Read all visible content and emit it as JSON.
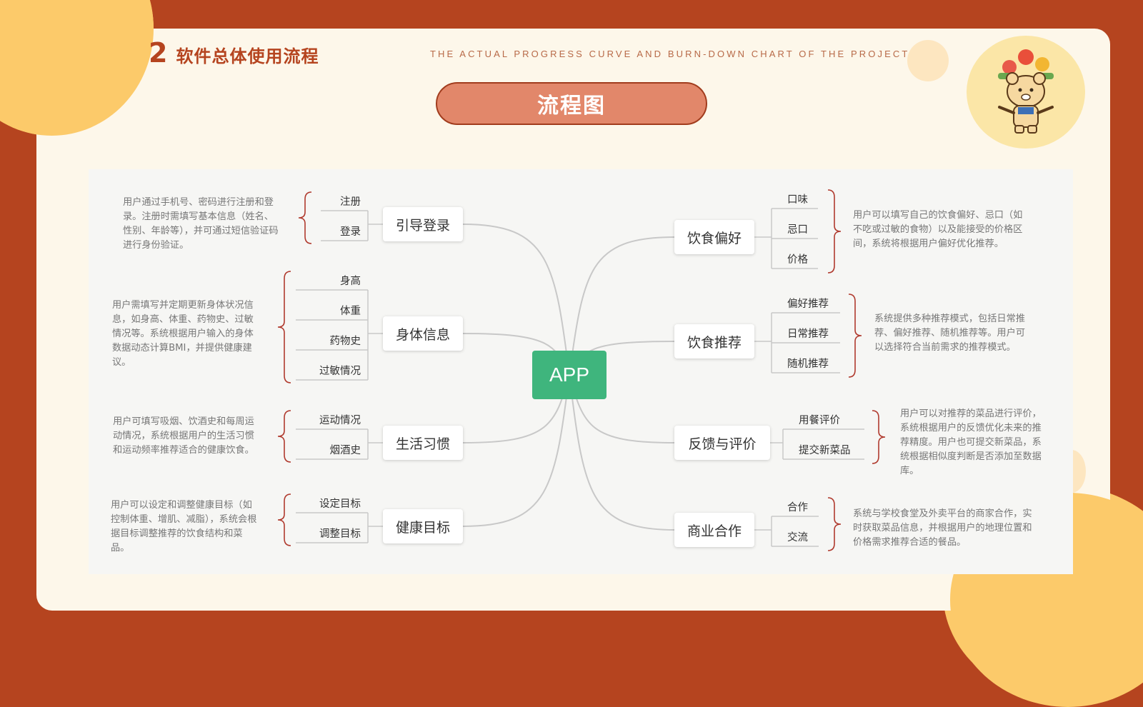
{
  "header": {
    "section_number": "2",
    "section_title": "软件总体使用流程",
    "subtitle": "THE ACTUAL PROGRESS CURVE AND BURN-DOWN CHART OF THE PROJECT",
    "badge": "流程图"
  },
  "diagram": {
    "center": "APP",
    "left": [
      {
        "label": "引导登录",
        "children": [
          "注册",
          "登录"
        ],
        "description": "用户通过手机号、密码进行注册和登录。注册时需填写基本信息（姓名、性别、年龄等），并可通过短信验证码进行身份验证。"
      },
      {
        "label": "身体信息",
        "children": [
          "身高",
          "体重",
          "药物史",
          "过敏情况"
        ],
        "description": "用户需填写并定期更新身体状况信息，如身高、体重、药物史、过敏情况等。系统根据用户输入的身体数据动态计算BMI，并提供健康建议。"
      },
      {
        "label": "生活习惯",
        "children": [
          "运动情况",
          "烟酒史"
        ],
        "description": "用户可填写吸烟、饮酒史和每周运动情况，系统根据用户的生活习惯和运动频率推荐适合的健康饮食。"
      },
      {
        "label": "健康目标",
        "children": [
          "设定目标",
          "调整目标"
        ],
        "description": "用户可以设定和调整健康目标（如控制体重、增肌、减脂），系统会根据目标调整推荐的饮食结构和菜品。"
      }
    ],
    "right": [
      {
        "label": "饮食偏好",
        "children": [
          "口味",
          "忌口",
          "价格"
        ],
        "description": "用户可以填写自己的饮食偏好、忌口（如不吃或过敏的食物）以及能接受的价格区间，系统将根据用户偏好优化推荐。"
      },
      {
        "label": "饮食推荐",
        "children": [
          "偏好推荐",
          "日常推荐",
          "随机推荐"
        ],
        "description": "系统提供多种推荐模式，包括日常推荐、偏好推荐、随机推荐等。用户可以选择符合当前需求的推荐模式。"
      },
      {
        "label": "反馈与评价",
        "children": [
          "用餐评价",
          "提交新菜品"
        ],
        "description": "用户可以对推荐的菜品进行评价，系统根据用户的反馈优化未来的推荐精度。用户也可提交新菜品，系统根据相似度判断是否添加至数据库。"
      },
      {
        "label": "商业合作",
        "children": [
          "合作",
          "交流"
        ],
        "description": "系统与学校食堂及外卖平台的商家合作，实时获取菜品信息，并根据用户的地理位置和价格需求推荐合适的餐品。"
      }
    ]
  },
  "colors": {
    "background": "#b5441f",
    "card": "#fdf7ea",
    "accent_yellow": "#fcca6a",
    "badge": "#e2876a",
    "app_node": "#3fb57d",
    "link": "#c8c8c8",
    "brace": "#b03a2e"
  },
  "mascot": {
    "icon": "bear-chef-mascot-icon"
  }
}
